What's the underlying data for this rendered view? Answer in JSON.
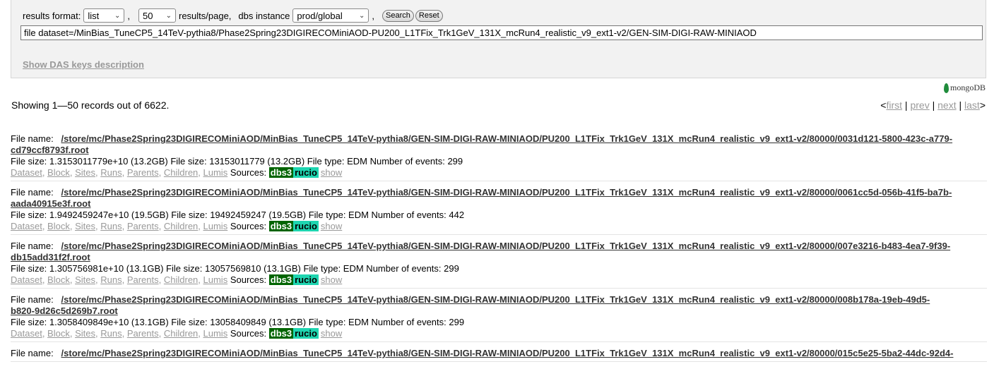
{
  "controls": {
    "results_format_label": "results format:",
    "results_format_value": "list",
    "per_page_value": "50",
    "per_page_label": "results/page,",
    "dbs_label": "dbs instance",
    "dbs_value": "prod/global",
    "search_label": "Search",
    "reset_label": "Reset",
    "query": "file dataset=/MinBias_TuneCP5_14TeV-pythia8/Phase2Spring23DIGIRECOMiniAOD-PU200_L1TFix_Trk1GeV_131X_mcRun4_realistic_v9_ext1-v2/GEN-SIM-DIGI-RAW-MINIAOD",
    "keys_link": "Show DAS keys description"
  },
  "brand": {
    "mongodb": "mongoDB"
  },
  "summary": {
    "showing": "Showing 1—50 records out of 6622."
  },
  "pager": {
    "first": "first",
    "prev": "prev",
    "next": "next",
    "last": "last"
  },
  "record_labels": {
    "file_name": "File name:",
    "sources": "Sources:",
    "dbs3": "dbs3",
    "rucio": "rucio",
    "show": "show",
    "links": [
      "Dataset",
      "Block",
      "Sites",
      "Runs",
      "Parents",
      "Children",
      "Lumis"
    ]
  },
  "records": [
    {
      "name_line1": "/store/mc/Phase2Spring23DIGIRECOMiniAOD/MinBias_TuneCP5_14TeV-pythia8/GEN-SIM-DIGI-RAW-MINIAOD/PU200_L1TFix_Trk1GeV_131X_mcRun4_realistic_v9_ext1-v2/80000/0031d121-5800-423c-a779-",
      "name_line2": "cd79ccf8793f.root",
      "info": "File size: 1.3153011779e+10 (13.2GB) File size: 13153011779 (13.2GB) File type: EDM Number of events: 299"
    },
    {
      "name_line1": "/store/mc/Phase2Spring23DIGIRECOMiniAOD/MinBias_TuneCP5_14TeV-pythia8/GEN-SIM-DIGI-RAW-MINIAOD/PU200_L1TFix_Trk1GeV_131X_mcRun4_realistic_v9_ext1-v2/80000/0061cc5d-056b-41f5-ba7b-",
      "name_line2": "aada40915e3f.root",
      "info": "File size: 1.9492459247e+10 (19.5GB) File size: 19492459247 (19.5GB) File type: EDM Number of events: 442"
    },
    {
      "name_line1": "/store/mc/Phase2Spring23DIGIRECOMiniAOD/MinBias_TuneCP5_14TeV-pythia8/GEN-SIM-DIGI-RAW-MINIAOD/PU200_L1TFix_Trk1GeV_131X_mcRun4_realistic_v9_ext1-v2/80000/007e3216-b483-4ea7-9f39-",
      "name_line2": "db15add31f2f.root",
      "info": "File size: 1.305756981e+10 (13.1GB) File size: 13057569810 (13.1GB) File type: EDM Number of events: 299"
    },
    {
      "name_line1": "/store/mc/Phase2Spring23DIGIRECOMiniAOD/MinBias_TuneCP5_14TeV-pythia8/GEN-SIM-DIGI-RAW-MINIAOD/PU200_L1TFix_Trk1GeV_131X_mcRun4_realistic_v9_ext1-v2/80000/008b178a-19eb-49d5-",
      "name_line2": "b820-9d26c5d269b7.root",
      "info": "File size: 1.3058409849e+10 (13.1GB) File size: 13058409849 (13.1GB) File type: EDM Number of events: 299"
    },
    {
      "name_line1": "/store/mc/Phase2Spring23DIGIRECOMiniAOD/MinBias_TuneCP5_14TeV-pythia8/GEN-SIM-DIGI-RAW-MINIAOD/PU200_L1TFix_Trk1GeV_131X_mcRun4_realistic_v9_ext1-v2/80000/015c5e25-5ba2-44dc-92d4-",
      "name_line2": "",
      "info": ""
    }
  ]
}
